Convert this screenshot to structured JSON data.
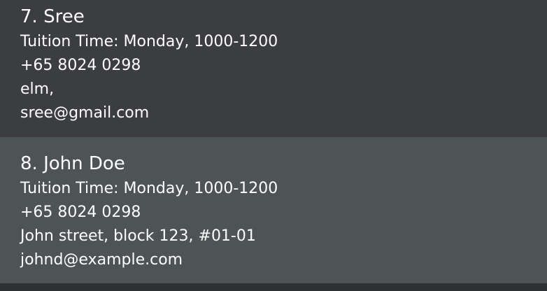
{
  "persons": [
    {
      "name": "7. Sree",
      "tuition_time": "Tuition Time: Monday, 1000-1200",
      "phone": "+65 8024 0298",
      "address": "elm,",
      "email": "sree@gmail.com"
    },
    {
      "name": "8. John Doe",
      "tuition_time": "Tuition Time: Monday, 1000-1200",
      "phone": "+65 8024 0298",
      "address": "John street, block 123, #01-01",
      "email": "johnd@example.com"
    }
  ],
  "colors": {
    "card_default": "#3b3d40",
    "card_selected": "#4e5355",
    "background": "#2f3033",
    "text": "#ffffff"
  }
}
